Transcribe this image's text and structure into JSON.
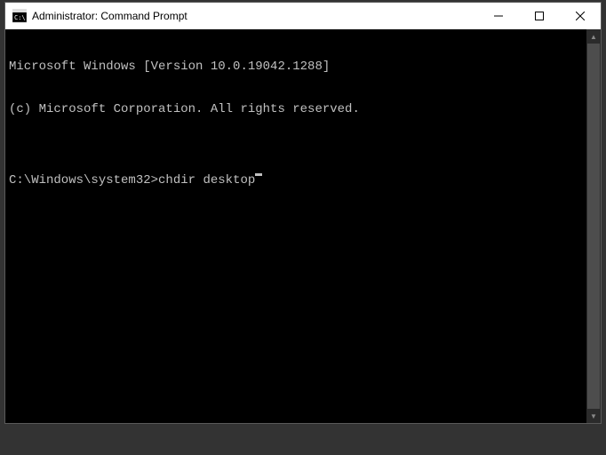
{
  "window": {
    "title": "Administrator: Command Prompt"
  },
  "terminal": {
    "line1": "Microsoft Windows [Version 10.0.19042.1288]",
    "line2": "(c) Microsoft Corporation. All rights reserved.",
    "blank": "",
    "prompt": "C:\\Windows\\system32>",
    "command": "chdir desktop"
  }
}
